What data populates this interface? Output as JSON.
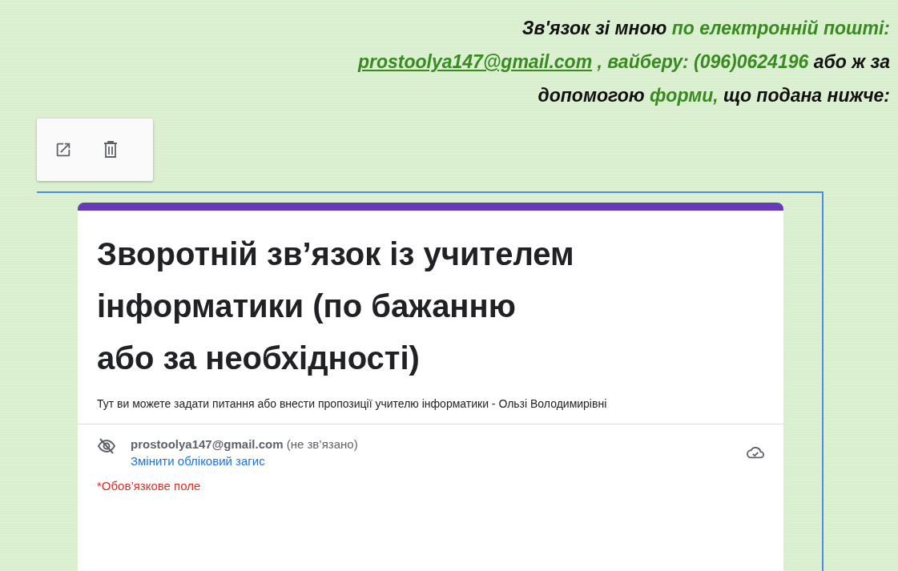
{
  "contact": {
    "lines": [
      [
        {
          "kind": "plain",
          "text": "Зв'язок зі мною "
        },
        {
          "kind": "green",
          "text": "по електронній пошті:"
        }
      ],
      [
        {
          "kind": "link",
          "text": "prostoolya147@gmail.com"
        },
        {
          "kind": "green",
          "text": " , вайберу: (096)0624196"
        },
        {
          "kind": "plain",
          "text": " або ж за"
        }
      ],
      [
        {
          "kind": "plain",
          "text": "допомогою "
        },
        {
          "kind": "green",
          "text": "форми,"
        },
        {
          "kind": "plain",
          "text": " що подана нижче:"
        }
      ]
    ]
  },
  "form": {
    "title": "Зворотній зв’язок із учителем інформатики (по бажанню або за необхідності)",
    "description": "Тут ви можете задати питання або внести пропозиції учителю інформатики - Ользі Володимирівні",
    "account": {
      "email": "prostoolya147@gmail.com",
      "status": "(не зв’язано)",
      "switch_link": "Змінити обліковий загис"
    },
    "required_note": "*Обов’язкове поле"
  }
}
